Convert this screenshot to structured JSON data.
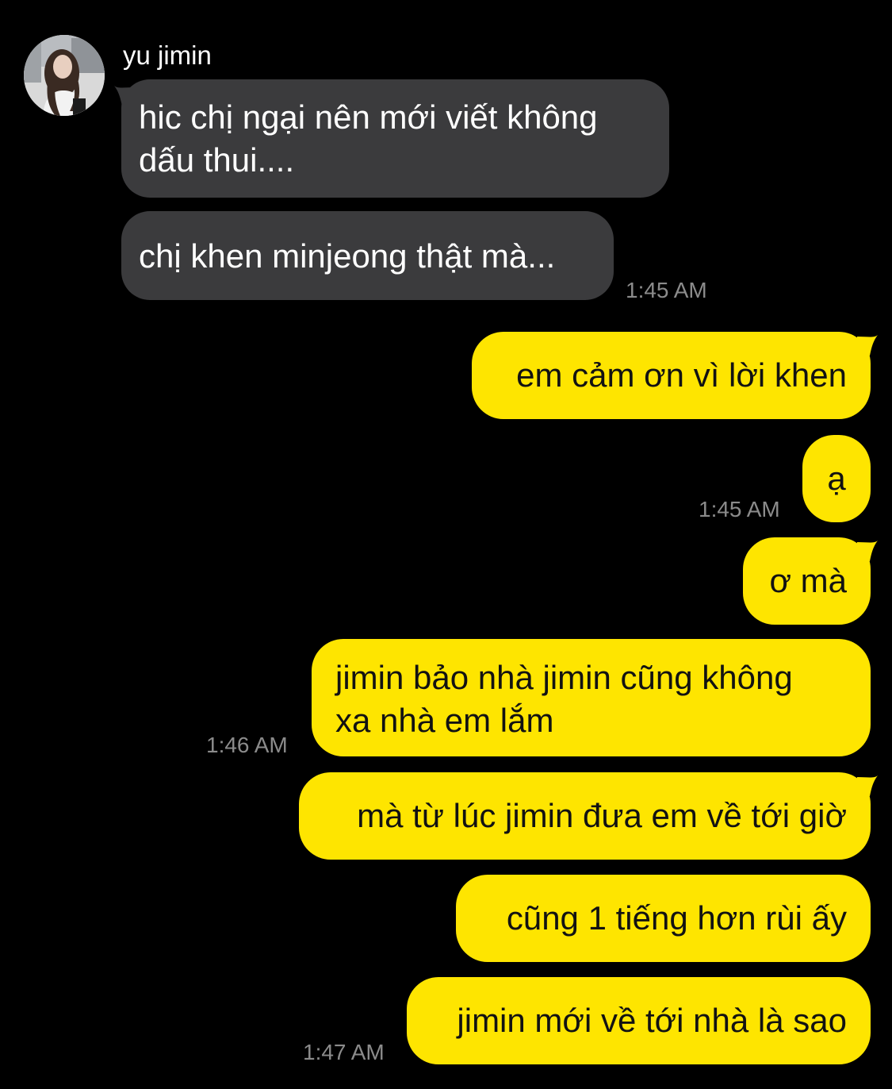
{
  "contact": {
    "name": "yu jimin",
    "avatar_icon": "profile-photo"
  },
  "messages": [
    {
      "side": "in",
      "text_lines": [
        "hic chị ngại nên mới viết không",
        "dấu thui...."
      ]
    },
    {
      "side": "in",
      "text_lines": [
        "chị khen minjeong thật mà..."
      ],
      "time": "1:45 AM"
    },
    {
      "side": "out",
      "text_lines": [
        "em cảm ơn vì lời khen"
      ]
    },
    {
      "side": "out",
      "text_lines": [
        "ạ"
      ],
      "time": "1:45 AM"
    },
    {
      "side": "out",
      "text_lines": [
        "ơ mà"
      ]
    },
    {
      "side": "out",
      "text_lines": [
        "jimin bảo nhà jimin cũng không",
        "xa nhà em lắm"
      ],
      "time": "1:46 AM"
    },
    {
      "side": "out",
      "text_lines": [
        "mà từ lúc jimin đưa em về tới giờ"
      ]
    },
    {
      "side": "out",
      "text_lines": [
        "cũng 1 tiếng hơn rùi ấy"
      ]
    },
    {
      "side": "out",
      "text_lines": [
        "jimin mới về tới nhà là sao"
      ],
      "time": "1:47 AM"
    }
  ],
  "colors": {
    "background": "#000000",
    "incoming_bubble": "#3b3b3d",
    "outgoing_bubble": "#fee500",
    "timestamp": "#8b8b8b"
  }
}
